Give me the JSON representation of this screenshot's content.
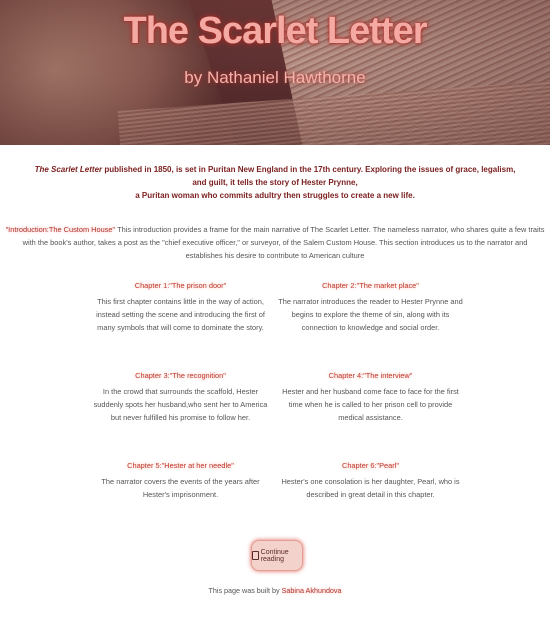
{
  "header": {
    "title": "The Scarlet Letter",
    "byline": "by Nathaniel Hawthorne"
  },
  "summary": {
    "book_title": "The Scarlet Letter",
    "line1_rest": " published in 1850, is set in Puritan New England in the 17th century. Exploring the issues of grace, legalism, and guilt, it tells the story of Hester Prynne,",
    "line2": "a Puritan woman who commits adultry then struggles to create a new life."
  },
  "introduction": {
    "label": "\"Introduction:The Custom House\"",
    "text": " This introduction provides a frame for the main narrative of The Scarlet Letter. The nameless narrator, who shares quite a few traits with the book's author, takes a post as the \"chief executive officer,\" or surveyor, of the Salem Custom House. This section introduces us to the narrator and establishes his desire to contribute to American culture"
  },
  "chapters": [
    {
      "title": "Chapter 1:\"The prison door\"",
      "text": "This first chapter contains little in the way of action, instead setting the scene and introducing the first of many symbols that will come to dominate the story."
    },
    {
      "title": "Chapter 2:\"The market place\"",
      "text": "The narrator introduces the reader to Hester Prynne and begins to explore the theme of sin, along with its connection to knowledge and social order."
    },
    {
      "title": "Chapter 3:\"The recognition\"",
      "text": "In the crowd that surrounds the scaffold, Hester suddenly spots her husband,who sent her to America but never fulfilled his promise to follow her."
    },
    {
      "title": "Chapter 4:\"The interview\"",
      "text": "Hester and her husband come face to face for the first time when he is called to her prison cell to provide medical assistance."
    },
    {
      "title": "Chapter 5:\"Hester at her needle\"",
      "text": "The narrator covers the events of the years after Hester's imprisonment."
    },
    {
      "title": "Chapter 6:\"Pearl\"",
      "text": "Hester's one consolation is her daughter, Pearl, who is described in great detail in this chapter."
    }
  ],
  "continue_button": {
    "label": "Continue reading",
    "icon": "book-icon"
  },
  "footer": {
    "prefix": "This page was built by ",
    "author": "Sabina Akhundova"
  },
  "colors": {
    "accent": "#c0392b",
    "summary_text": "#7a1d1d",
    "button_bg": "#f4d2cc"
  }
}
